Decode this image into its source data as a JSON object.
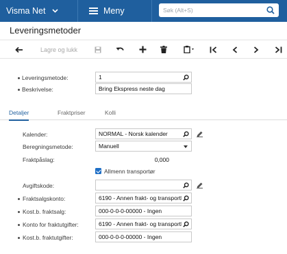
{
  "topbar": {
    "brand": "Visma Net",
    "menu_label": "Meny",
    "search_placeholder": "Søk (Alt+S)",
    "color": "#1f5f9e"
  },
  "page_title": "Leveringsmetoder",
  "toolbar": {
    "back_icon": "arrow-left-icon",
    "save_close_label": "Lagre og lukk",
    "save_icon": "floppy-icon",
    "undo_icon": "undo-icon",
    "add_icon": "plus-icon",
    "delete_icon": "trash-icon",
    "copy_paste_icon": "clipboard-icon",
    "first_icon": "first-record-icon",
    "prev_icon": "previous-record-icon",
    "next_icon": "next-record-icon",
    "last_icon": "last-record-icon"
  },
  "header_form": {
    "leveringsmetode_label": "Leveringsmetode:",
    "leveringsmetode_value": "1",
    "beskrivelse_label": "Beskrivelse:",
    "beskrivelse_value": "Bring Ekspress neste dag"
  },
  "tabs": [
    {
      "label": "Detaljer",
      "active": true
    },
    {
      "label": "Fraktpriser",
      "active": false
    },
    {
      "label": "Kolli",
      "active": false
    }
  ],
  "details": {
    "kalender_label": "Kalender:",
    "kalender_value": "NORMAL - Norsk kalender",
    "beregningsmetode_label": "Beregningsmetode:",
    "beregningsmetode_value": "Manuell",
    "fraktpaslag_label": "Fraktpåslag:",
    "fraktpaslag_value": "0,000",
    "allmenn_label": "Allmenn transportør",
    "allmenn_checked": true,
    "avgiftskode_label": "Avgiftskode:",
    "avgiftskode_value": "",
    "fraktsalgskonto_label": "Fraktsalgskonto:",
    "fraktsalgskonto_value": "6190 - Annen frakt- og transportk",
    "kostb_fraktsalg_label": "Kost.b. fraktsalg:",
    "kostb_fraktsalg_value": "000-0-0-0-00000 - Ingen",
    "konto_fraktutgifter_label": "Konto for fraktutgifter:",
    "konto_fraktutgifter_value": "6190 - Annen frakt- og transportk",
    "kostb_fraktutgifter_label": "Kost.b. fraktutgifter:",
    "kostb_fraktutgifter_value": "000-0-0-0-00000 - Ingen"
  }
}
